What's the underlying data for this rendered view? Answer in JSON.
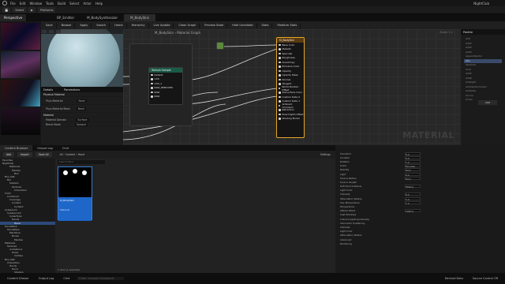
{
  "menu": {
    "items": [
      "File",
      "Edit",
      "Window",
      "Tools",
      "Build",
      "Select",
      "Actor",
      "Help"
    ],
    "project": "NightClub"
  },
  "toolbar": {
    "select_mode": "Select",
    "platforms": "Platforms"
  },
  "tabs": {
    "viewport": "Perspective",
    "editor_tabs": [
      "BP_Emitter",
      "M_BodySynthesizer",
      "M_BodySkin"
    ]
  },
  "graph_toolbar": {
    "items": [
      "Save",
      "Browse",
      "Apply",
      "Search",
      "Home",
      "Hierarchy",
      "Live Update",
      "Clean Graph",
      "Preview State",
      "Hide Unrelated",
      "Stats",
      "Platform Stats"
    ]
  },
  "breadcrumb": {
    "asset": "M_BodySkin",
    "section": "Material Graph"
  },
  "zoom": "Zoom 1:1",
  "details_panel": {
    "title": "Details",
    "tab2": "Parameters",
    "section1": "Physical Material",
    "phys_mat": "Phys Material",
    "phys_mat_value": "None",
    "section2": "Material",
    "material_domain": "Material Domain",
    "material_domain_value": "Surface",
    "blend_mode": "Blend Mode",
    "blend_mode_value": "Opaque",
    "phys_mask": "Phys Material Mask",
    "phys_mask_value": "None"
  },
  "texture_node": {
    "title": "Texture Sample",
    "pins": [
      "Default",
      "UV0",
      "UV0_1",
      "RAW_REMOVED",
      "RAW",
      "RAW"
    ]
  },
  "main_node": {
    "title": "M_BodySkin",
    "pins": [
      "Base Color",
      "Metallic",
      "Specular",
      "Roughness",
      "Anisotropy",
      "Emissive Color",
      "Opacity",
      "Opacity Mask",
      "Normal",
      "Tangent",
      "World Position Offset",
      "Subsurface Color",
      "Custom Data 0",
      "Custom Data 1",
      "Ambient Occlusion",
      "Refraction",
      "Pixel Depth Offset",
      "Shading Model"
    ]
  },
  "watermark": "MATERIAL",
  "palette": {
    "title": "Palette",
    "items": [
      "Add",
      "Add2",
      "Add3",
      "Add4",
      "AppendVector",
      "Abs",
      "Absolute",
      "Acos",
      "Add5",
      "Add6",
      "AddLight",
      "AmbientOcclusion",
      "AntiAlias",
      "Arccos",
      "Arcsin"
    ]
  },
  "content_browser": {
    "tabs": [
      "Content Browser",
      "Output Log",
      "Cmd"
    ],
    "add_label": "Add",
    "import": "Import",
    "save_all": "Save All",
    "breadcrumb": [
      "All",
      "Content",
      "Hand"
    ],
    "settings": "Settings",
    "search_placeholder": "Search Hand",
    "status": "1 item (1 selected)"
  },
  "tree": {
    "items": [
      "Favorites",
      "NightClub",
      "Materials",
      "Meshes",
      "Blur",
      "Blur_Mat",
      "Bar",
      "Shaders",
      "Textures",
      "Characters",
      "Cloth",
      "Combined",
      "Coverage",
      "Content",
      "Content",
      "Cyberpunk",
      "Cyberpunk2",
      "CyberTools",
      "Hands",
      "Hand",
      "HandsPack",
      "HandsPack",
      "ManStore",
      "Bones",
      "Meshes",
      "Materials",
      "Textures",
      "Animations",
      "Poses",
      "Clothes",
      "Blur_Mat",
      "Characters",
      "Hands",
      "Hand",
      "Shaders",
      "Starter",
      "Cyberpunk",
      "Materials"
    ]
  },
  "asset": {
    "name": "M_BodySkin",
    "type": "Material"
  },
  "details2": {
    "rows": [
      "Transform",
      "Location",
      "Rotation",
      "Scale",
      "Mobility",
      "Light",
      "Source Radius",
      "Source Length",
      "Soft Source Radius",
      "Light Color",
      "Intensity",
      "Attenuation Radius",
      "Use Temperature",
      "Temperature",
      "Affects World",
      "Cast Shadows",
      "Indirect Lighting Intensity",
      "Volumetric Scattering",
      "Intensity",
      "Light Color",
      "Attenuation Radius",
      "Advanced",
      "Rendering"
    ],
    "values": [
      "0.0",
      "0.0",
      "1.0",
      "Movable",
      "64.0",
      "0.0",
      "64.0",
      "",
      "6500.0",
      "",
      "8.0",
      "1.0",
      "1.0",
      "",
      "1000.0"
    ]
  },
  "statusbar": {
    "items": [
      "Content Drawer",
      "Output Log",
      "Cmd",
      "Enter Console Command",
      "Derived Data",
      "Source Control Off"
    ]
  }
}
